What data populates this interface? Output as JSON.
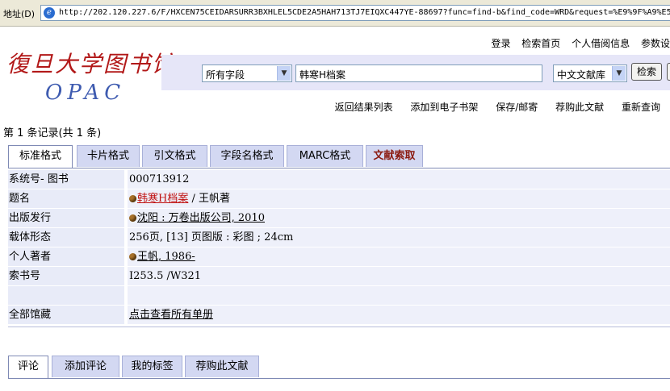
{
  "address_bar": {
    "label": "地址(D)",
    "url": "http://202.120.227.6/F/HXCEN75CEIDARSURR3BXHLEL5CDE2A5HAH713TJ7EIQXC447YE-88697?func=find-b&find_code=WRD&request=%E9%9F%A9%E5%"
  },
  "header": {
    "logo_cn": "復旦大学图书馆",
    "logo_opac": "OPAC",
    "top_links": [
      "登录",
      "检索首页",
      "个人借阅信息",
      "参数设"
    ]
  },
  "search": {
    "field_select": "所有字段",
    "query": "韩寒H档案",
    "db_select": "中文文献库",
    "search_button": "检索"
  },
  "action_links": [
    "返回结果列表",
    "添加到电子书架",
    "保存/邮寄",
    "荐购此文献",
    "重新查询"
  ],
  "record_count": "第 1 条记录(共 1 条)",
  "format_tabs": [
    "标准格式",
    "卡片格式",
    "引文格式",
    "字段名格式",
    "MARC格式",
    "文献索取"
  ],
  "record": {
    "system_no_label": "系统号- 图书",
    "system_no": "000713912",
    "title_label": "题名",
    "title_link": "韩寒H档案",
    "title_rest": " / 王帆著",
    "publish_label": "出版发行",
    "publish": "沈阳 : 万卷出版公司, 2010",
    "carrier_label": "载体形态",
    "carrier": "256页, [13] 页图版 : 彩图 ; 24cm",
    "author_label": "个人著者",
    "author": "王帆, 1986-",
    "callno_label": "索书号",
    "callno": "I253.5 /W321",
    "holdings_label": "全部馆藏",
    "holdings": "点击查看所有单册"
  },
  "comment_tabs": [
    "评论",
    "添加评论",
    "我的标签",
    "荐购此文献"
  ]
}
